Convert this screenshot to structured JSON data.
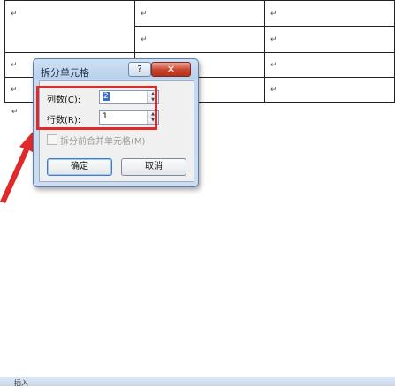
{
  "document": {
    "paragraph_mark": "↵"
  },
  "dialog": {
    "title": "拆分单元格",
    "help_label": "?",
    "close_label": "✕",
    "columns_label": "列数(C):",
    "columns_value": "2",
    "rows_label": "行数(R):",
    "rows_value": "1",
    "merge_before_split_label": "拆分前合并单元格(M)",
    "merge_before_split_checked": false,
    "ok_label": "确定",
    "cancel_label": "取消"
  },
  "status": {
    "tab_label": "插入"
  },
  "colors": {
    "highlight_red": "#e02a2a",
    "dialog_frame": "#5a7fa8"
  }
}
